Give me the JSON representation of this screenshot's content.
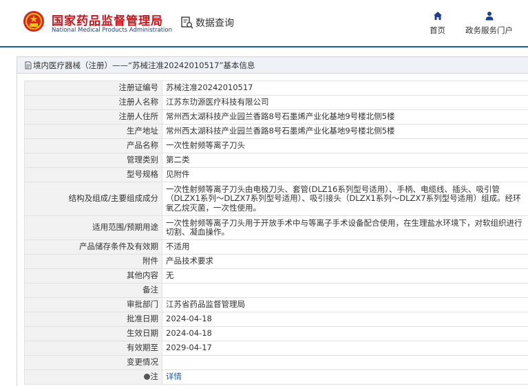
{
  "header": {
    "brand_cn": "国家药品监督管理局",
    "brand_en": "National Medical Products Administration",
    "query_label": "数据查询",
    "nav_home": "首页",
    "nav_portal": "政务服务门户"
  },
  "breadcrumb": "境内医疗器械（注册）——“苏械注准20242010517”基本信息",
  "rows": [
    {
      "label": "注册证编号",
      "value": "苏械注准20242010517"
    },
    {
      "label": "注册人名称",
      "value": "江苏东玏源医疗科技有限公司"
    },
    {
      "label": "注册人住所",
      "value": "常州西太湖科技产业园兰香路8号石墨烯产业化基地9号楼北侧5楼"
    },
    {
      "label": "生产地址",
      "value": "常州西太湖科技产业园兰香路8号石墨烯产业化基地9号楼北侧5楼"
    },
    {
      "label": "产品名称",
      "value": "一次性射频等离子刀头"
    },
    {
      "label": "管理类别",
      "value": "第二类"
    },
    {
      "label": "型号规格",
      "value": "见附件"
    },
    {
      "label": "结构及组成/主要组成成分",
      "value": "一次性射频等离子刀头由电极刀头、套管(DLZ16系列型号适用）、手柄、电缆线、插头、吸引管（DLZX1系列～DLZX7系列型号适用）、吸引接头（DLZX1系列～DLZX7系列型号适用）组成。经环氧乙烷灭菌，一次性使用。"
    },
    {
      "label": "适用范围/预期用途",
      "value": "一次性射频等离子刀头用于开放手术中与等离子手术设备配合使用，在生理盐水环境下，对软组织进行切割、凝血操作。"
    },
    {
      "label": "产品储存条件及有效期",
      "value": "不适用"
    },
    {
      "label": "附件",
      "value": "产品技术要求"
    },
    {
      "label": "其他内容",
      "value": "无"
    },
    {
      "label": "备注",
      "value": ""
    },
    {
      "label": "审批部门",
      "value": "江苏省药品监督管理局"
    },
    {
      "label": "批准日期",
      "value": "2024-04-18"
    },
    {
      "label": "生效日期",
      "value": "2024-04-18"
    },
    {
      "label": "有效期至",
      "value": "2029-04-17"
    },
    {
      "label": "变更情况",
      "value": ""
    },
    {
      "label": "注",
      "value": "详情"
    }
  ]
}
